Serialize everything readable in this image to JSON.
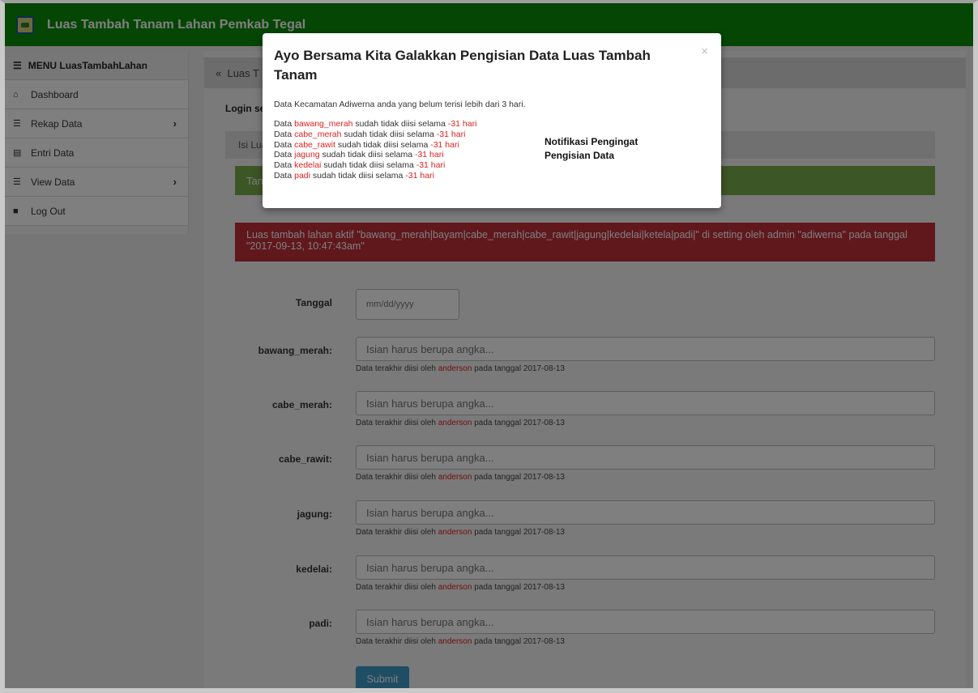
{
  "header": {
    "title": "Luas Tambah Tanam Lahan Pemkab Tegal"
  },
  "sidebar": {
    "menu_title": "MENU LuasTambahLahan",
    "items": [
      {
        "label": "Dashboard",
        "icon": "home-icon"
      },
      {
        "label": "Rekap Data",
        "icon": "list-icon",
        "has_submenu": true
      },
      {
        "label": "Entri Data",
        "icon": "form-icon"
      },
      {
        "label": "View Data",
        "icon": "list-icon",
        "has_submenu": true
      },
      {
        "label": "Log Out",
        "icon": "lock-icon"
      }
    ]
  },
  "content": {
    "breadcrumb_prefix": "Luas T",
    "login_text": "Login se",
    "info_text": "Isi Lua",
    "green_text": "Tan",
    "alert": "Luas tambah lahan aktif \"bawang_merah|bayam|cabe_merah|cabe_rawit|jagung|kedelai|ketela|padi|\" di setting oleh admin \"adiwerna\" pada tanggal \"2017-09-13, 10:47:43am\""
  },
  "form": {
    "date_label": "Tanggal",
    "date_placeholder": "mm/dd/yyyy",
    "input_placeholder": "Isian harus berupa angka...",
    "help_prefix": "Data terakhir diisi oleh",
    "help_user": "anderson",
    "help_suffix": "pada tanggal 2017-08-13",
    "fields": [
      {
        "label": "bawang_merah:"
      },
      {
        "label": "cabe_merah:"
      },
      {
        "label": "cabe_rawit:"
      },
      {
        "label": "jagung:"
      },
      {
        "label": "kedelai:"
      },
      {
        "label": "padi:"
      }
    ],
    "submit_label": "Submit"
  },
  "modal": {
    "title": "Ayo Bersama Kita Galakkan Pengisian Data Luas Tambah Tanam",
    "close": "×",
    "lead": "Data Kecamatan Adiwerna anda yang belum terisi lebih dari 3 hari.",
    "item_prefix": "Data",
    "item_middle": "sudah tidak diisi selama",
    "item_days": "-31 hari",
    "items": [
      "bawang_merah",
      "cabe_merah",
      "cabe_rawit",
      "jagung",
      "kedelai",
      "padi"
    ],
    "note": "Notifikasi Pengingat Pengisian Data"
  },
  "colors": {
    "header_green": "#0a8c0a",
    "alert_red": "#c1303b",
    "accent_red": "#e02020",
    "button_blue": "#3c9bc9"
  }
}
